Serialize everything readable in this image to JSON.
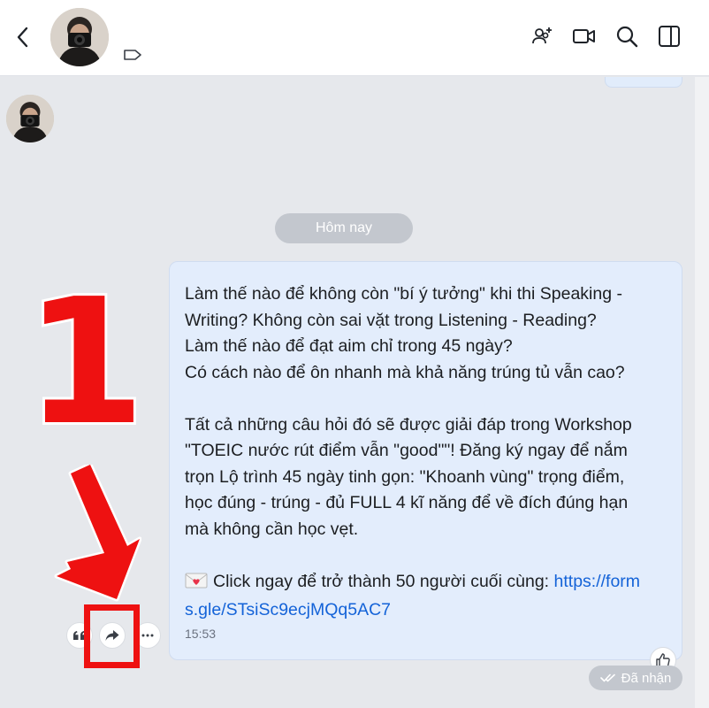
{
  "header": {
    "icons": [
      "back-icon",
      "tag-icon",
      "add-member-icon",
      "video-call-icon",
      "search-icon",
      "sidebar-toggle-icon"
    ]
  },
  "chat": {
    "date_separator": "Hôm nay",
    "message": {
      "lines": [
        "Làm thế nào để không còn \"bí ý tưởng\" khi thi Speaking -",
        "Writing? Không còn sai vặt trong Listening - Reading?",
        "Làm thế nào để đạt aim chỉ trong 45 ngày?",
        "Có cách nào để ôn nhanh mà khả năng trúng tủ vẫn cao?",
        "",
        "Tất cả những câu hỏi đó sẽ được giải đáp trong Workshop",
        "\"TOEIC nước rút điểm vẫn \"good\"\"! Đăng ký ngay để nắm",
        "trọn Lộ trình 45 ngày tinh gọn: \"Khoanh vùng\" trọng điểm,",
        "học đúng - trúng - đủ FULL 4 kĩ năng để về đích đúng hạn",
        "mà không cần học vẹt.",
        ""
      ],
      "cta_text": "Click ngay để trở thành 50 người cuối cùng: ",
      "link_part1": "https://form",
      "link_part2": "s.gle/STsiSc9ecjMQq5AC7",
      "time": "15:53",
      "status": "Đã nhận"
    },
    "actions": [
      "quote",
      "forward",
      "more"
    ]
  },
  "annotation": {
    "step_number": "1",
    "color": "#ee1111"
  }
}
